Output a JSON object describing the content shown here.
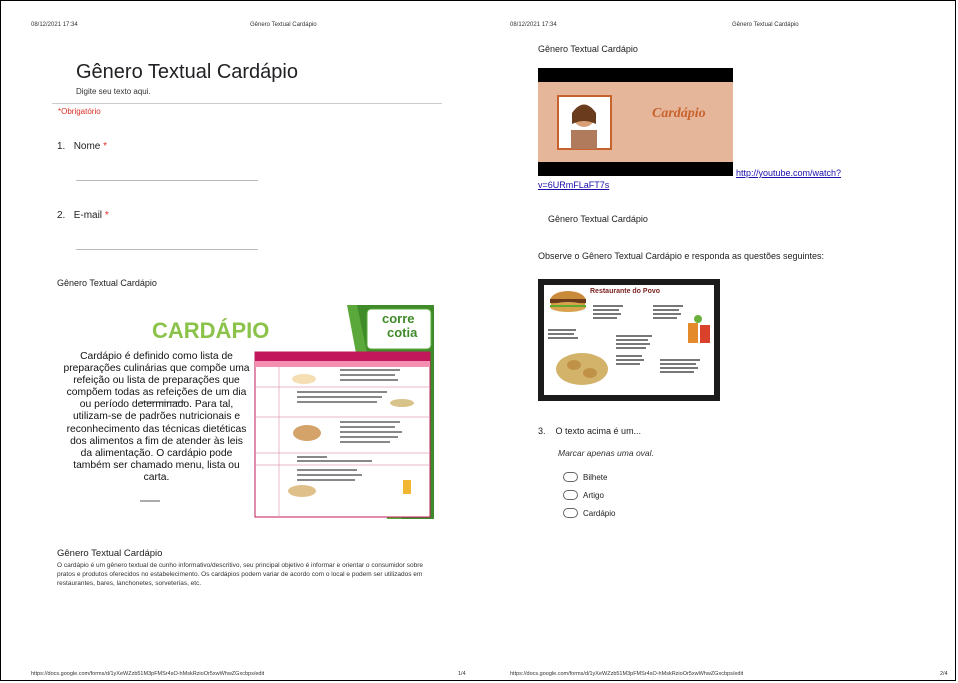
{
  "page1": {
    "header_datetime": "08/12/2021 17:34",
    "header_title": "Gênero Textual Cardápio",
    "form_title": "Gênero Textual Cardápio",
    "form_description": "Digite seu texto aqui.",
    "required_note": "*Obrigatório",
    "questions": [
      {
        "number": "1.",
        "label": "Nome",
        "required_mark": "*"
      },
      {
        "number": "2.",
        "label": "E-mail",
        "required_mark": "*"
      }
    ],
    "section_title": "Gênero Textual Cardápio",
    "image": {
      "heading": "CARDÁPIO",
      "brand": "corre cotia",
      "body_text": "Cardápio é definido como lista de preparações culinárias que compõe uma refeição ou lista de preparações que compõem todas as refeições de um dia ou período determinado. Para tal, utilizam-se de padrões nutricionais e reconhecimento das técnicas dietéticas dos alimentos a fim de atender às leis da alimentação. O cardápio pode também ser chamado menu, lista ou carta."
    },
    "desc_title": "Gênero Textual Cardápio",
    "desc_text": "O cardápio é um gênero textual de cunho informativo/descritivo, seu principal objetivo é informar e orientar o consumidor sobre pratos e produtos oferecidos no estabelecimento. Os cardápios podem variar de acordo com o local e podem ser utilizados em restaurantes, bares, lanchonetes, sorveterias, etc.",
    "footer_url": "https://docs.google.com/forms/d/1yXeWZzb51M3pFMSr4sO-hMskRzioOr5xwWhwZGxcbps/edit",
    "footer_page": "1/4"
  },
  "page2": {
    "header_datetime": "08/12/2021 17:34",
    "header_title": "Gênero Textual Cardápio",
    "section_title": "Gênero Textual Cardápio",
    "video_caption": "Cardápio",
    "video_link_line1": "http://youtube.com/watch?",
    "video_link_line2": "v=6URmFLaFT7s",
    "subsection_title": "Gênero Textual Cardápio",
    "instruction": "Observe o Gênero Textual Cardápio e responda as questões seguintes:",
    "menu_image_title": "Restaurante do Povo",
    "question": {
      "number": "3.",
      "label": "O texto acima é um...",
      "hint": "Marcar apenas uma oval."
    },
    "options": [
      "Bilhete",
      "Artigo",
      "Cardápio"
    ],
    "footer_url": "https://docs.google.com/forms/d/1yXeWZzb51M3pFMSr4sO-hMskRzioOr5xwWhwZGxcbps/edit",
    "footer_page": "2/4"
  }
}
